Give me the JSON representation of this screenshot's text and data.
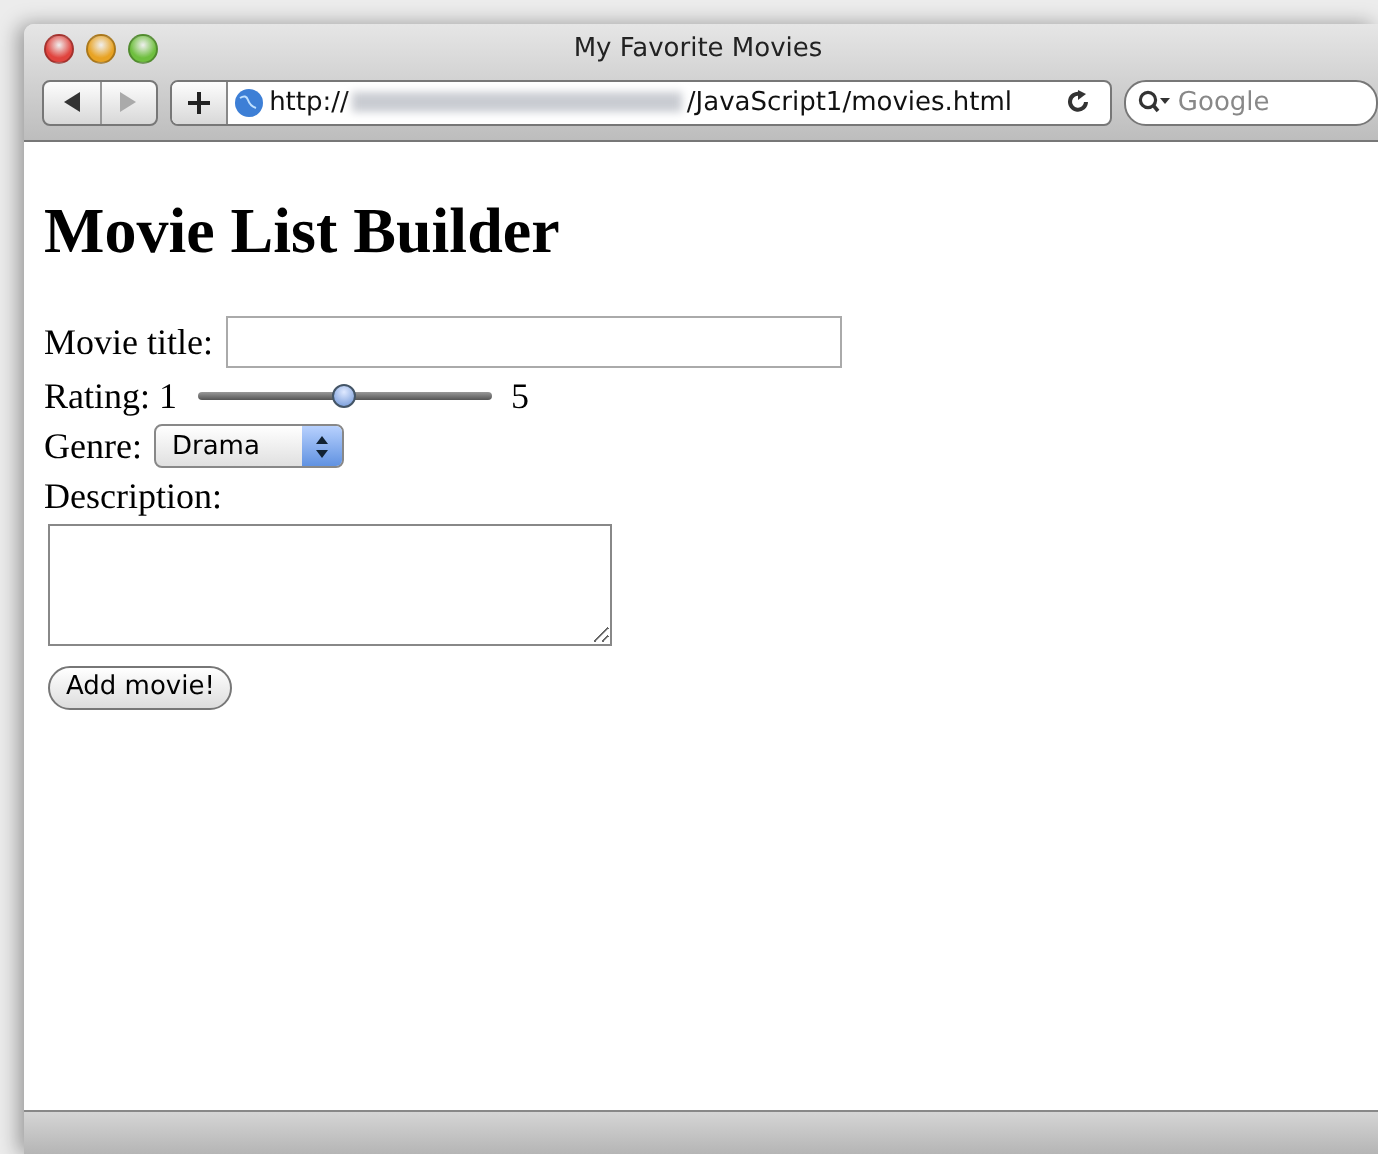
{
  "window": {
    "title": "My Favorite Movies"
  },
  "toolbar": {
    "url_start": "http://",
    "url_end": "/JavaScript1/movies.html",
    "search_placeholder": "Google"
  },
  "page": {
    "heading": "Movie List Builder",
    "title_label": "Movie title:",
    "rating": {
      "label": "Rating:",
      "min": "1",
      "max": "5",
      "level": 0.5
    },
    "genre": {
      "label": "Genre:",
      "value": "Drama"
    },
    "description_label": "Description:",
    "button": "Add movie!"
  }
}
